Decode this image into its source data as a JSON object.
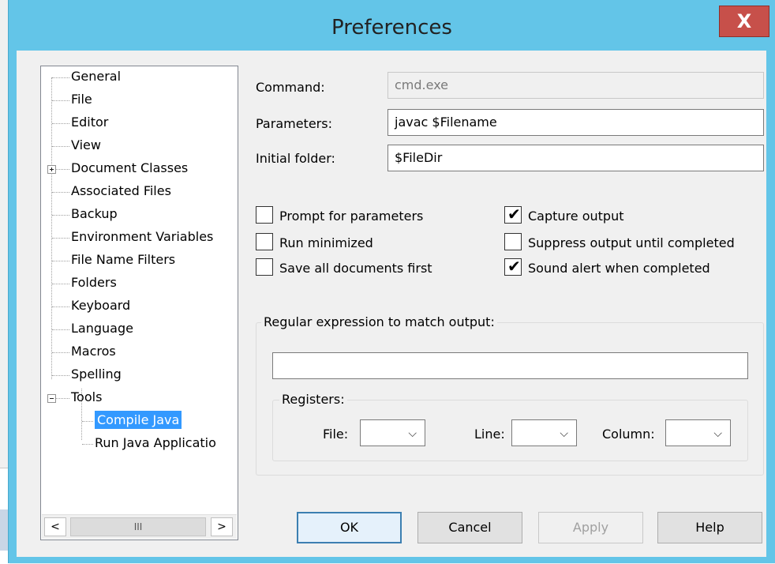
{
  "window": {
    "title": "Preferences",
    "close_label": "X"
  },
  "tree": {
    "items": [
      {
        "label": "General"
      },
      {
        "label": "File"
      },
      {
        "label": "Editor"
      },
      {
        "label": "View"
      },
      {
        "label": "Document Classes",
        "expander": "plus"
      },
      {
        "label": "Associated Files"
      },
      {
        "label": "Backup"
      },
      {
        "label": "Environment Variables"
      },
      {
        "label": "File Name Filters"
      },
      {
        "label": "Folders"
      },
      {
        "label": "Keyboard"
      },
      {
        "label": "Language"
      },
      {
        "label": "Macros"
      },
      {
        "label": "Spelling"
      },
      {
        "label": "Tools",
        "expander": "minus"
      },
      {
        "label": "Compile Java",
        "selected": true
      },
      {
        "label": "Run Java Applicatio"
      }
    ],
    "scroll_left": "<",
    "scroll_thumb": "III",
    "scroll_right": ">"
  },
  "form": {
    "command_label": "Command:",
    "command_value": "cmd.exe",
    "parameters_label": "Parameters:",
    "parameters_value": "javac $Filename",
    "folder_label": "Initial folder:",
    "folder_value": "$FileDir"
  },
  "options": {
    "prompt": {
      "label": "Prompt for parameters",
      "checked": false
    },
    "minimized": {
      "label": "Run minimized",
      "checked": false
    },
    "save_all": {
      "label": "Save all documents first",
      "checked": false
    },
    "capture": {
      "label": "Capture output",
      "checked": true
    },
    "suppress": {
      "label": "Suppress output until completed",
      "checked": false
    },
    "sound": {
      "label": "Sound alert when completed",
      "checked": true
    },
    "check_glyph": "✔"
  },
  "regex": {
    "group_title": "Regular expression to match output:",
    "value": "",
    "registers_title": "Registers:",
    "file_label": "File:",
    "line_label": "Line:",
    "column_label": "Column:",
    "arrow": "⌵"
  },
  "buttons": {
    "ok": "OK",
    "cancel": "Cancel",
    "apply": "Apply",
    "help": "Help"
  }
}
